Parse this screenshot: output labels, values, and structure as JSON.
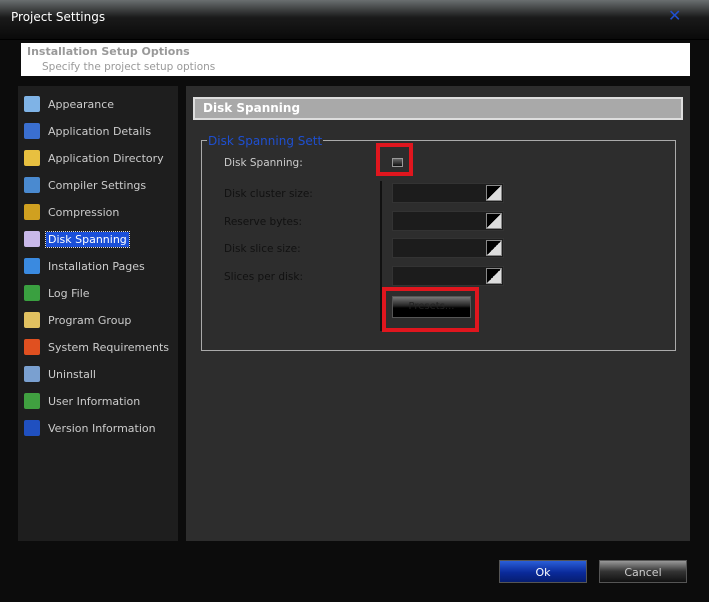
{
  "window": {
    "title": "Project Settings"
  },
  "header": {
    "title": "Installation Setup Options",
    "subtitle": "Specify the project setup options"
  },
  "sidebar": {
    "items": [
      {
        "label": "Appearance",
        "color": "#7fb3e6"
      },
      {
        "label": "Application Details",
        "color": "#3a6fd0"
      },
      {
        "label": "Application Directory",
        "color": "#e8c040"
      },
      {
        "label": "Compiler Settings",
        "color": "#4a8ad0"
      },
      {
        "label": "Compression",
        "color": "#d0a020"
      },
      {
        "label": "Disk Spanning",
        "color": "#c8b8e8",
        "selected": true
      },
      {
        "label": "Installation Pages",
        "color": "#3a8ae0"
      },
      {
        "label": "Log File",
        "color": "#3aa040"
      },
      {
        "label": "Program Group",
        "color": "#e0c060"
      },
      {
        "label": "System Requirements",
        "color": "#e05020"
      },
      {
        "label": "Uninstall",
        "color": "#7aa0d0"
      },
      {
        "label": "User Information",
        "color": "#40a040"
      },
      {
        "label": "Version Information",
        "color": "#2050c0"
      }
    ]
  },
  "main": {
    "section_title": "Disk Spanning",
    "group_title": "Disk Spanning Sett",
    "disk_spanning_label": "Disk Spanning:",
    "disk_spanning_checked": false,
    "fields": [
      {
        "label": "Disk cluster size:",
        "value": ""
      },
      {
        "label": "Reserve bytes:",
        "value": ""
      },
      {
        "label": "Disk slice size:",
        "value": ""
      },
      {
        "label": "Slices per disk:",
        "value": ""
      }
    ],
    "button_label": "Presets..."
  },
  "footer": {
    "ok": "Ok",
    "cancel": "Cancel"
  }
}
